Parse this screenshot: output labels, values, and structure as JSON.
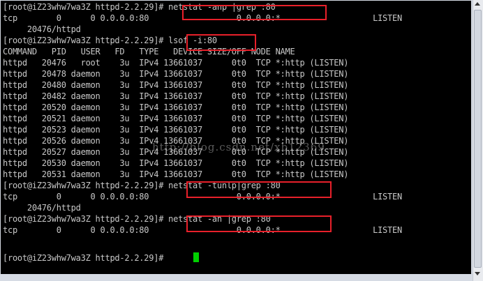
{
  "terminal": {
    "lines": [
      "[root@iZ23whw7wa3Z httpd-2.2.29]# netstat -anp |grep :80",
      "tcp        0      0 0.0.0.0:80                  0.0.0.0:*                   LISTEN",
      "     20476/httpd",
      "[root@iZ23whw7wa3Z httpd-2.2.29]# lsof -i:80",
      "COMMAND   PID   USER   FD   TYPE   DEVICE SIZE/OFF NODE NAME",
      "httpd   20476   root    3u  IPv4 13661037      0t0  TCP *:http (LISTEN)",
      "httpd   20478 daemon    3u  IPv4 13661037      0t0  TCP *:http (LISTEN)",
      "httpd   20480 daemon    3u  IPv4 13661037      0t0  TCP *:http (LISTEN)",
      "httpd   20482 daemon    3u  IPv4 13661037      0t0  TCP *:http (LISTEN)",
      "httpd   20520 daemon    3u  IPv4 13661037      0t0  TCP *:http (LISTEN)",
      "httpd   20521 daemon    3u  IPv4 13661037      0t0  TCP *:http (LISTEN)",
      "httpd   20523 daemon    3u  IPv4 13661037      0t0  TCP *:http (LISTEN)",
      "httpd   20526 daemon    3u  IPv4 13661037      0t0  TCP *:http (LISTEN)",
      "httpd   20527 daemon    3u  IPv4 13661037      0t0  TCP *:http (LISTEN)",
      "httpd   20530 daemon    3u  IPv4 13661037      0t0  TCP *:http (LISTEN)",
      "httpd   20531 daemon    3u  IPv4 13661037      0t0  TCP *:http (LISTEN)",
      "[root@iZ23whw7wa3Z httpd-2.2.29]# netstat -tunlp|grep :80",
      "tcp        0      0 0.0.0.0:80                  0.0.0.0:*                   LISTEN",
      "     20476/httpd",
      "[root@iZ23whw7wa3Z httpd-2.2.29]# netstat -an |grep :80",
      "tcp        0      0 0.0.0.0:80                  0.0.0.0:*                   LISTEN",
      "",
      "[root@iZ23whw7wa3Z httpd-2.2.29]# "
    ],
    "watermark": "http://blog.csdn.net/xb12369"
  },
  "colors": {
    "background": "#000000",
    "text": "#c8c8c8",
    "highlight_box": "#e8202a",
    "cursor": "#00d000"
  }
}
